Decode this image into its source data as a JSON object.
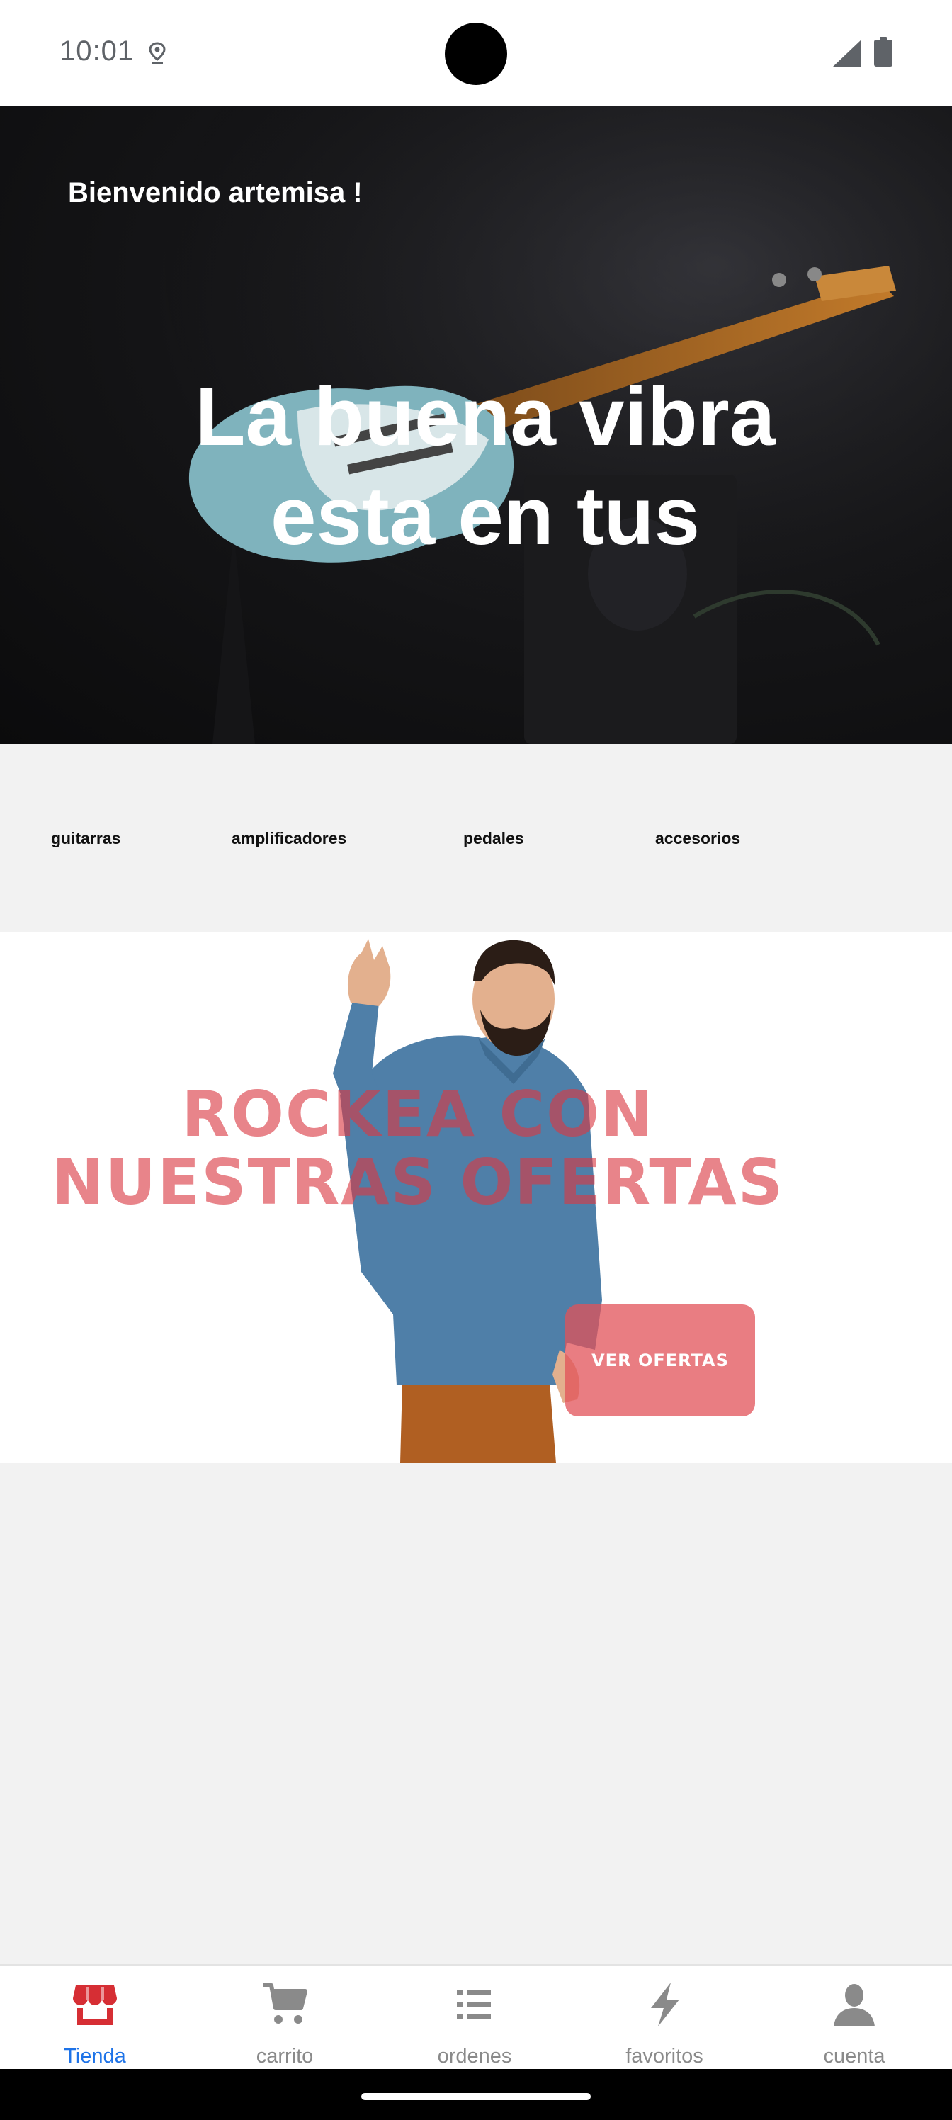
{
  "status_bar": {
    "time": "10:01",
    "notification_icon": "location-pin-icon",
    "signal_icon": "signal-icon",
    "battery_icon": "battery-icon"
  },
  "hero": {
    "welcome": "Bienvenido artemisa !",
    "title_line1": "La buena vibra",
    "title_line2": "esta en tus",
    "image": "electric-guitar-photo"
  },
  "categories": [
    {
      "label": "guitarras"
    },
    {
      "label": "amplificadores"
    },
    {
      "label": "pedales"
    },
    {
      "label": "accesorios"
    }
  ],
  "promo": {
    "title_line1": "ROCKEA CON",
    "title_line2": "NUESTRAS OFERTAS",
    "button_label": "VER OFERTAS",
    "image": "man-rock-sign-photo",
    "accent_color": "#e25258"
  },
  "bottom_nav": [
    {
      "label": "Tienda",
      "icon": "store-icon",
      "active": true
    },
    {
      "label": "carrito",
      "icon": "cart-icon",
      "active": false
    },
    {
      "label": "ordenes",
      "icon": "list-icon",
      "active": false
    },
    {
      "label": "favoritos",
      "icon": "lightning-icon",
      "active": false
    },
    {
      "label": "cuenta",
      "icon": "person-icon",
      "active": false
    }
  ],
  "colors": {
    "active_nav": "#1e73e8",
    "inactive_nav": "#8a8a8a",
    "store_icon": "#d62e34"
  }
}
